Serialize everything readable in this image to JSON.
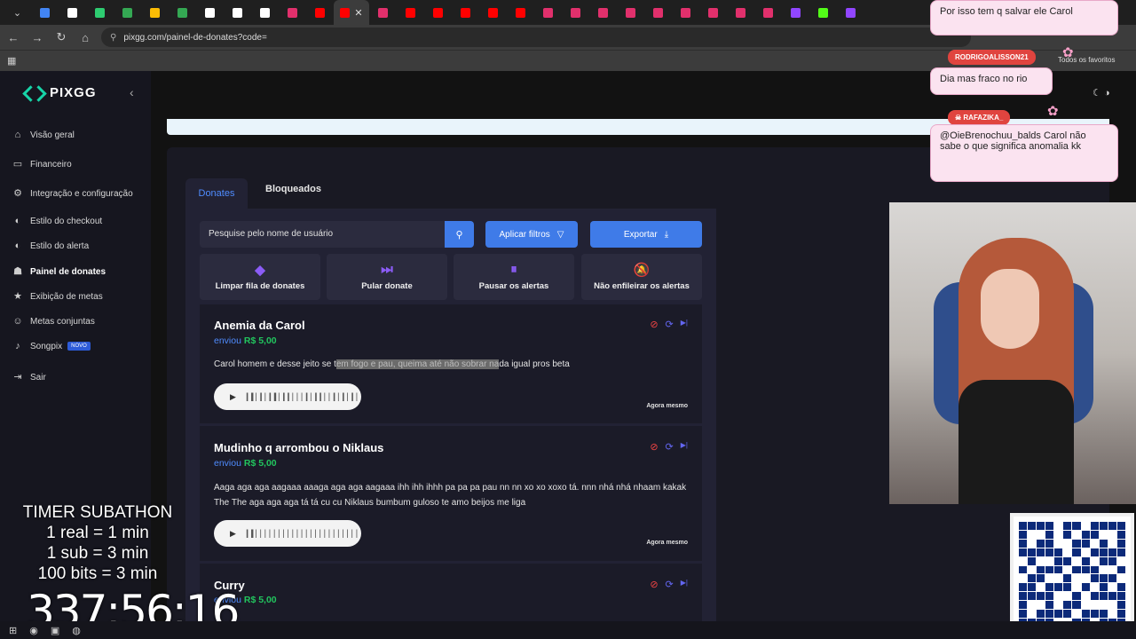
{
  "browser": {
    "url": "pixgg.com/painel-de-donates?code=",
    "bookmarks_label": "Todos os favoritos",
    "tab_colors": [
      "#4285f4",
      "#ffffff",
      "#2ecc71",
      "#34a853",
      "#fbbc05",
      "#34a853",
      "#ffffff",
      "#ffffff",
      "#ffffff",
      "#e1306c",
      "#ff0000",
      "#ff0000",
      "#e1306c",
      "#ff0000",
      "#ff0000",
      "#ff0000",
      "#ff0000",
      "#ff0000",
      "#e1306c",
      "#e1306c",
      "#e1306c",
      "#e1306c",
      "#e1306c",
      "#e1306c",
      "#e1306c",
      "#e1306c",
      "#e1306c",
      "#9146ff",
      "#53fc18",
      "#9146ff"
    ]
  },
  "sidebar": {
    "logo": "PIXGG",
    "items": [
      {
        "label": "Visão geral",
        "icon": "home-icon",
        "glyph": "⌂"
      },
      {
        "label": "Financeiro",
        "icon": "wallet-icon",
        "glyph": "▭"
      },
      {
        "label": "Integração e configuração",
        "icon": "gear-icon",
        "glyph": "⚙"
      },
      {
        "label": "Estilo do checkout",
        "icon": "palette-icon",
        "glyph": "◐"
      },
      {
        "label": "Estilo do alerta",
        "icon": "palette-icon",
        "glyph": "◐"
      },
      {
        "label": "Painel de donates",
        "icon": "donate-icon",
        "glyph": "☗"
      },
      {
        "label": "Exibição de metas",
        "icon": "star-icon",
        "glyph": "★"
      },
      {
        "label": "Metas conjuntas",
        "icon": "users-icon",
        "glyph": "☺"
      },
      {
        "label": "Songpix",
        "icon": "music-icon",
        "glyph": "♪",
        "badge": "NOVO"
      },
      {
        "label": "Sair",
        "icon": "logout-icon",
        "glyph": "⇥"
      }
    ]
  },
  "tabs": {
    "donates": "Donates",
    "blocked": "Bloqueados"
  },
  "toolbar": {
    "search_placeholder": "Pesquise pelo nome de usuário",
    "filter_label": "Aplicar filtros",
    "export_label": "Exportar"
  },
  "actions": [
    {
      "label": "Limpar fila de donates",
      "icon": "eraser-icon",
      "glyph": "◆"
    },
    {
      "label": "Pular donate",
      "icon": "skip-icon",
      "glyph": "⏭"
    },
    {
      "label": "Pausar os alertas",
      "icon": "pause-icon",
      "glyph": "⏸"
    },
    {
      "label": "Não enfileirar os alertas",
      "icon": "bell-off-icon",
      "glyph": "🔕"
    }
  ],
  "donates": [
    {
      "name": "Anemia da Carol",
      "sent": "enviou",
      "amount": "R$ 5,00",
      "msg_before": "Carol homem e desse jeito se t",
      "msg_highlight": "em fogo e pau, queima até não sobrar na",
      "msg_after": "da igual pros beta",
      "time": "Agora mesmo"
    },
    {
      "name": "Mudinho q arrombou o Niklaus",
      "sent": "enviou",
      "amount": "R$ 5,00",
      "msg_before": "Aaga aga aga aagaaa aaaga aga aga aagaaa ihh ihh ihhh pa pa pa pau nn nn xo xo xoxo tá. nnn nhá nhá nhaam kakak The The aga aga aga tá tá cu cu Niklaus bumbum guloso te amo beijos me liga",
      "msg_highlight": "",
      "msg_after": "",
      "time": "Agora mesmo"
    },
    {
      "name": "Curry",
      "sent": "enviou",
      "amount": "R$ 5,00"
    }
  ],
  "chat": [
    {
      "user": "",
      "text": "Por isso tem q salvar ele Carol"
    },
    {
      "user": "RODRIGOALISSON21",
      "text": "Dia mas fraco no rio"
    },
    {
      "user": "RAFAZIKA_",
      "text": "@OieBrenochuu_balds Carol não sabe o que significa anomalia kk"
    }
  ],
  "timer": {
    "title": "TIMER SUBATHON",
    "line1": "1 real = 1 min",
    "line2": "1 sub = 3 min",
    "line3": "100 bits = 3 min",
    "value": "337:56:16"
  }
}
